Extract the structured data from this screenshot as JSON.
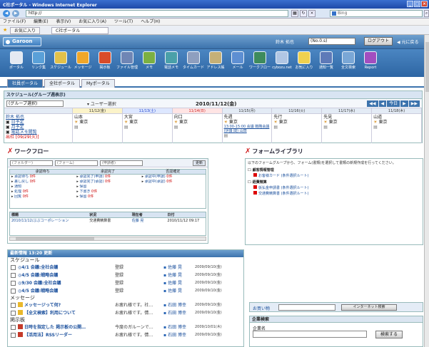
{
  "window": {
    "title": "C社ポータル - Windows Internet Explorer"
  },
  "address": {
    "url": "http://",
    "search_placeholder": "Bing"
  },
  "menubar": [
    "ファイル(F)",
    "編集(E)",
    "表示(V)",
    "お気に入り(A)",
    "ツール(T)",
    "ヘルプ(H)"
  ],
  "browser_tabs": {
    "favorites": "お気に入り",
    "current": "C社ポータル"
  },
  "header": {
    "logo": "Garoon",
    "user": "鈴木 拓也",
    "menu_select": "(No.0.s)",
    "logout": "ログアウト",
    "arrow": "◀ 元に戻る"
  },
  "apps": [
    {
      "label": "ポータル",
      "color": "#e4e9f2"
    },
    {
      "label": "リンク集",
      "color": "#5aa0d8"
    },
    {
      "label": "スケジュール",
      "color": "#e2c14a"
    },
    {
      "label": "メッセージ",
      "color": "#f0a72a"
    },
    {
      "label": "掲示板",
      "color": "#d94c2a"
    },
    {
      "label": "ファイル管理",
      "color": "#6f86b5"
    },
    {
      "label": "メモ",
      "color": "#7bb043"
    },
    {
      "label": "電話メモ",
      "color": "#4aa0a9"
    },
    {
      "label": "タイムカード",
      "color": "#8e9fbf"
    },
    {
      "label": "アドレス帳",
      "color": "#c5b077"
    },
    {
      "label": "メール",
      "color": "#5d8fd2"
    },
    {
      "label": "ワークフロー",
      "color": "#3e8b5d"
    },
    {
      "label": "cybozu.net",
      "color": "#b0c6e4"
    },
    {
      "label": "お気に入り",
      "color": "#f0d14f"
    },
    {
      "label": "通知一覧",
      "color": "#5e7ab8"
    },
    {
      "label": "全文検索",
      "color": "#7aa7d6"
    },
    {
      "label": "Report",
      "color": "#a24ec0"
    }
  ],
  "portal_tabs": [
    "社員ポータル",
    "全社ポータル",
    "Myポータル"
  ],
  "schedule": {
    "title": "スケジュール(グループ週表示)",
    "group_select": "(グループ選択)",
    "user_select": "ユーザー選択",
    "date": "2010/11/12(金)",
    "nav": [
      "◀◀",
      "◀",
      "今日",
      "▶",
      "▶▶"
    ],
    "days": [
      {
        "label": "11/12(金)",
        "kind": "today"
      },
      {
        "label": "11/13(土)",
        "kind": "sat"
      },
      {
        "label": "11/14(日)",
        "kind": "sun"
      },
      {
        "label": "11/15(月)",
        "kind": ""
      },
      {
        "label": "11/16(火)",
        "kind": ""
      },
      {
        "label": "11/17(水)",
        "kind": ""
      },
      {
        "label": "11/18(木)",
        "kind": ""
      }
    ],
    "user": {
      "name": "鈴木 拓也",
      "links": [
        "日予定",
        "月予定",
        "電話メモ閲覧"
      ],
      "notice": "出社 [09/29(火)]"
    },
    "cells": [
      {
        "weather": "山本",
        "loc": "東京"
      },
      {
        "weather": "大宮",
        "loc": "東京"
      },
      {
        "weather": "向口",
        "loc": "東京"
      },
      {
        "weather": "先週",
        "loc": "東京",
        "event": "13:00-15:00 会議 戦略会議 (評議 関) 山田"
      },
      {
        "weather": "先行",
        "loc": "東京"
      },
      {
        "weather": "先見",
        "loc": "東京"
      },
      {
        "weather": "山道",
        "loc": "東京"
      }
    ]
  },
  "workflow": {
    "title": "ワークフロー",
    "filter_placeholders": [
      "(フォルダー)",
      "(フォーム)",
      "(申請者)"
    ],
    "update": "更新",
    "cols": [
      "承認待ち",
      "承認完了",
      "否認確定"
    ],
    "rows": [
      [
        {
          "t": "承認待ち",
          "c": "0件"
        },
        {
          "t": "承認完了(申請)",
          "c": "0件"
        },
        {
          "t": "承認中(申請)",
          "c": "0件"
        }
      ],
      [
        {
          "t": "差し戻し",
          "c": "0件"
        },
        {
          "t": "承認完了(承認)",
          "c": "0件"
        },
        {
          "t": "承認中(承認)",
          "c": "0件"
        }
      ],
      [
        {
          "t": "通知",
          "c": ""
        },
        {
          "t": "保留",
          "c": ""
        },
        {
          "t": "",
          "c": ""
        }
      ],
      [
        {
          "t": "処理",
          "c": "0件"
        },
        {
          "t": "下書き",
          "c": "0件"
        },
        {
          "t": "",
          "c": ""
        }
      ],
      [
        {
          "t": "回覧",
          "c": "0件"
        },
        {
          "t": "保留",
          "c": "0件"
        },
        {
          "t": "",
          "c": ""
        }
      ]
    ],
    "table_headers": [
      "標題",
      "状況",
      "現在者",
      "日付"
    ],
    "table_rows": [
      {
        "title": "2010/11/12/ぶぶコーポレーション",
        "status": "交通費精算書",
        "person": "佐藤 晃",
        "date": "2010/11/12 09:17"
      }
    ]
  },
  "formlib": {
    "title": "フォームライブラリ",
    "desc": "以下のフォームグループから、フォーム(書類)を選択して書類の新規作成を行ってください。",
    "categories": [
      {
        "name": "顧客情報管理",
        "items": [
          "お客様カード (条件選択ルート)"
        ]
      },
      {
        "name": "経費精算",
        "items": [
          "仮払金申請書 (条件選択ルート)",
          "交通費精算書 (条件選択ルート)"
        ]
      }
    ]
  },
  "news": {
    "title": "最新情報 13:20 更新",
    "sections": [
      {
        "name": "スケジュール",
        "items": [
          {
            "title": "◎4/1 会議:全社会議",
            "status": "登録",
            "user": "佐藤 晃",
            "date": "2009/09/10(金)",
            "icon": ""
          },
          {
            "title": "◎4/5 会議:戦略会議",
            "status": "登録",
            "user": "佐藤 晃",
            "date": "2009/09/10(金)",
            "icon": ""
          },
          {
            "title": "◎9/30 会議:全社会議",
            "status": "登録",
            "user": "佐藤 晃",
            "date": "2009/09/10(金)",
            "icon": ""
          },
          {
            "title": "◎4/5 会議:戦略会議",
            "status": "登録",
            "user": "佐藤 晃",
            "date": "2009/09/10(金)",
            "icon": ""
          }
        ]
      },
      {
        "name": "メッセージ",
        "items": [
          {
            "title": "メッセージって何?",
            "status": "お疲れ様です。社…",
            "user": "石田 博幸",
            "date": "2009/09/10(金)",
            "icon": "msg"
          },
          {
            "title": "【全文検索】利用について",
            "status": "お疲れ様です。情…",
            "user": "石田 博幸",
            "date": "2009/09/10(金)",
            "icon": "msg"
          }
        ]
      },
      {
        "name": "掲示板",
        "items": [
          {
            "title": "日時を指定した 掲示板の公開…",
            "status": "今度のガルーンで…",
            "user": "石田 博幸",
            "date": "2009/10/01(木)",
            "icon": "bbs"
          },
          {
            "title": "【活用法】RSSリーダー",
            "status": "お疲れ様です。情…",
            "user": "石田 博幸",
            "date": "2009/09/10(金)",
            "icon": "bbs"
          }
        ]
      }
    ]
  },
  "shopping": {
    "label": "お買い物",
    "button": "インターネット検索"
  },
  "corp_search": {
    "title": "企業検索",
    "label": "企業名",
    "button": "検索する"
  }
}
